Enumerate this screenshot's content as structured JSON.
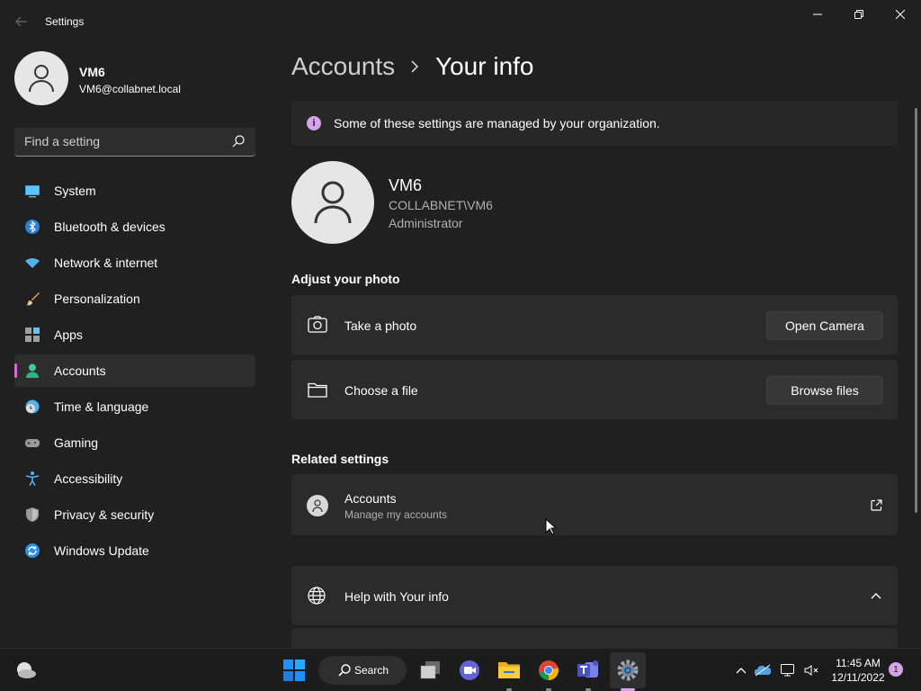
{
  "window": {
    "app_title": "Settings"
  },
  "profile": {
    "name": "VM6",
    "email": "VM6@collabnet.local"
  },
  "search": {
    "placeholder": "Find a setting"
  },
  "sidebar": {
    "items": [
      {
        "label": "System",
        "icon": "monitor-icon",
        "active": false
      },
      {
        "label": "Bluetooth & devices",
        "icon": "bluetooth-icon",
        "active": false
      },
      {
        "label": "Network & internet",
        "icon": "wifi-icon",
        "active": false
      },
      {
        "label": "Personalization",
        "icon": "brush-icon",
        "active": false
      },
      {
        "label": "Apps",
        "icon": "apps-icon",
        "active": false
      },
      {
        "label": "Accounts",
        "icon": "person-icon",
        "active": true
      },
      {
        "label": "Time & language",
        "icon": "clock-globe-icon",
        "active": false
      },
      {
        "label": "Gaming",
        "icon": "gamepad-icon",
        "active": false
      },
      {
        "label": "Accessibility",
        "icon": "accessibility-icon",
        "active": false
      },
      {
        "label": "Privacy & security",
        "icon": "shield-icon",
        "active": false
      },
      {
        "label": "Windows Update",
        "icon": "update-icon",
        "active": false
      }
    ]
  },
  "breadcrumb": {
    "parent": "Accounts",
    "current": "Your info"
  },
  "banner": {
    "icon_text": "i",
    "text": "Some of these settings are managed by your organization."
  },
  "user": {
    "name": "VM6",
    "domain": "COLLABNET\\VM6",
    "role": "Administrator"
  },
  "adjust_photo": {
    "heading": "Adjust your photo",
    "take_photo": {
      "label": "Take a photo",
      "button": "Open Camera"
    },
    "choose_file": {
      "label": "Choose a file",
      "button": "Browse files"
    }
  },
  "related": {
    "heading": "Related settings",
    "accounts": {
      "label": "Accounts",
      "sub": "Manage my accounts"
    }
  },
  "help": {
    "label": "Help with Your info"
  },
  "taskbar": {
    "search_label": "Search",
    "time": "11:45 AM",
    "date": "12/11/2022",
    "notification_count": "1"
  },
  "colors": {
    "accent": "#d16fd0",
    "background": "#202020",
    "card": "#2b2b2b"
  }
}
